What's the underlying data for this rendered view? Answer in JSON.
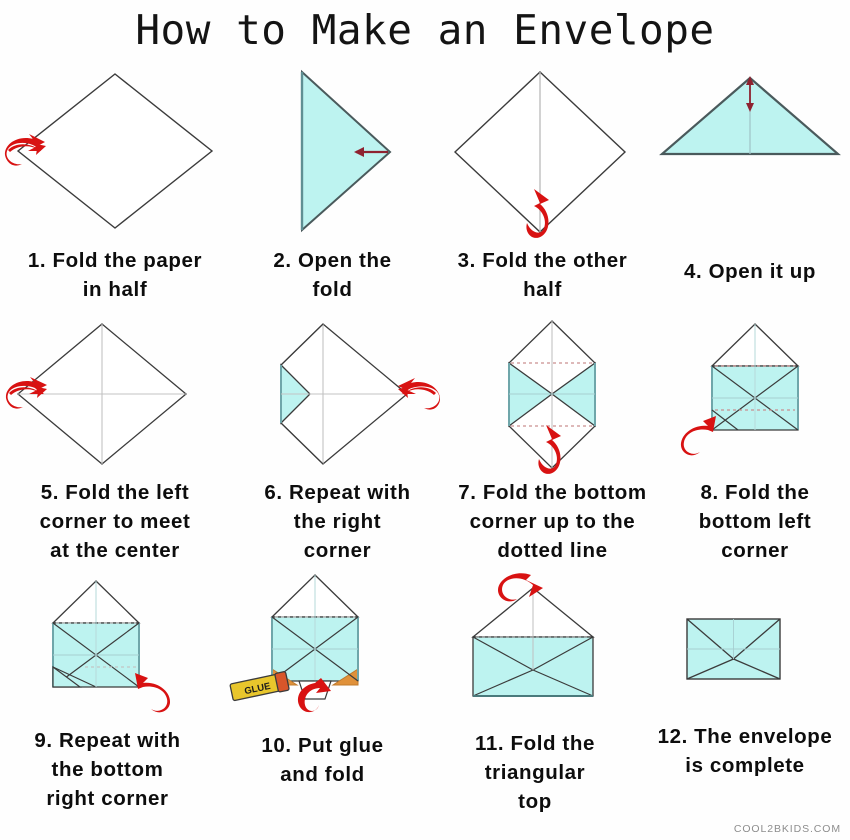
{
  "title": "How to Make an Envelope",
  "watermark": "COOL2BKIDS.COM",
  "colors": {
    "paper_fill": "#ffffff",
    "folded_fill": "#bdf3f0",
    "folded_fill_dark": "#a7ebe8",
    "outline": "#3b3b3b",
    "crease": "#b9b9b9",
    "dotted": "#c98f8f",
    "arrow_red": "#d81212",
    "arrow_dark_red": "#8e2230",
    "glue_body": "#e8c62c",
    "glue_cap": "#d8562a",
    "glue_shade": "#e0913a",
    "title_color": "#141414",
    "caption_color": "#0d0d0d",
    "watermark_color": "#8d8d8d"
  },
  "steps": [
    {
      "number": "1.",
      "text": "Fold the paper\nin half",
      "caption": "1. Fold the paper\nin half",
      "figure": "diamond-flat",
      "arrow": "curl-left",
      "arrow_position": "left-corner"
    },
    {
      "number": "2.",
      "text": "Open the\nfold",
      "caption": "2. Open the\nfold",
      "figure": "triangle-right",
      "arrow": "straight-left",
      "arrow_position": "right-point"
    },
    {
      "number": "3.",
      "text": "Fold the other\nhalf",
      "caption": "3. Fold the other\nhalf",
      "figure": "diamond-vertical-crease",
      "arrow": "curl-down",
      "arrow_position": "bottom-corner"
    },
    {
      "number": "4.",
      "text": "Open it up",
      "caption": "4. Open it up",
      "figure": "triangle-wide",
      "arrow": "double-vertical",
      "arrow_position": "apex"
    },
    {
      "number": "5.",
      "text": "Fold the left\ncorner to meet\nat the center",
      "caption": "5. Fold the left\ncorner to meet\nat the center",
      "figure": "diamond-cross-crease",
      "arrow": "curl-left",
      "arrow_position": "left-corner"
    },
    {
      "number": "6.",
      "text": "Repeat with\nthe right\ncorner",
      "caption": "6. Repeat with\nthe right\ncorner",
      "figure": "left-corner-folded",
      "arrow": "curl-right",
      "arrow_position": "right-corner"
    },
    {
      "number": "7.",
      "text": "Fold the bottom\ncorner up to the\ndotted line",
      "caption": "7. Fold the bottom\ncorner up to the\ndotted line",
      "figure": "both-sides-folded",
      "arrow": "curl-down",
      "arrow_position": "bottom-corner"
    },
    {
      "number": "8.",
      "text": "Fold the\nbottom left\ncorner",
      "caption": "8. Fold the\nbottom left\ncorner",
      "figure": "bottom-folded-up",
      "arrow": "curl-up-left",
      "arrow_position": "bottom-left"
    },
    {
      "number": "9.",
      "text": "Repeat with\nthe bottom\nright corner",
      "caption": "9. Repeat with\nthe bottom\nright corner",
      "figure": "bottom-left-folded",
      "arrow": "curl-up-right",
      "arrow_position": "bottom-right"
    },
    {
      "number": "10.",
      "text": "Put glue\nand fold",
      "caption": "10. Put glue\nand fold",
      "figure": "glue-applied",
      "arrow": "curl-up",
      "arrow_position": "bottom-center",
      "glue_label": "GLUE"
    },
    {
      "number": "11.",
      "text": "Fold the\ntriangular\ntop",
      "caption": "11. Fold the\ntriangular\ntop",
      "figure": "open-envelope",
      "arrow": "curl-down-top",
      "arrow_position": "flap-tip"
    },
    {
      "number": "12.",
      "text": "The envelope\nis complete",
      "caption": "12. The envelope\nis complete",
      "figure": "closed-envelope",
      "arrow": "none",
      "arrow_position": "none"
    }
  ]
}
